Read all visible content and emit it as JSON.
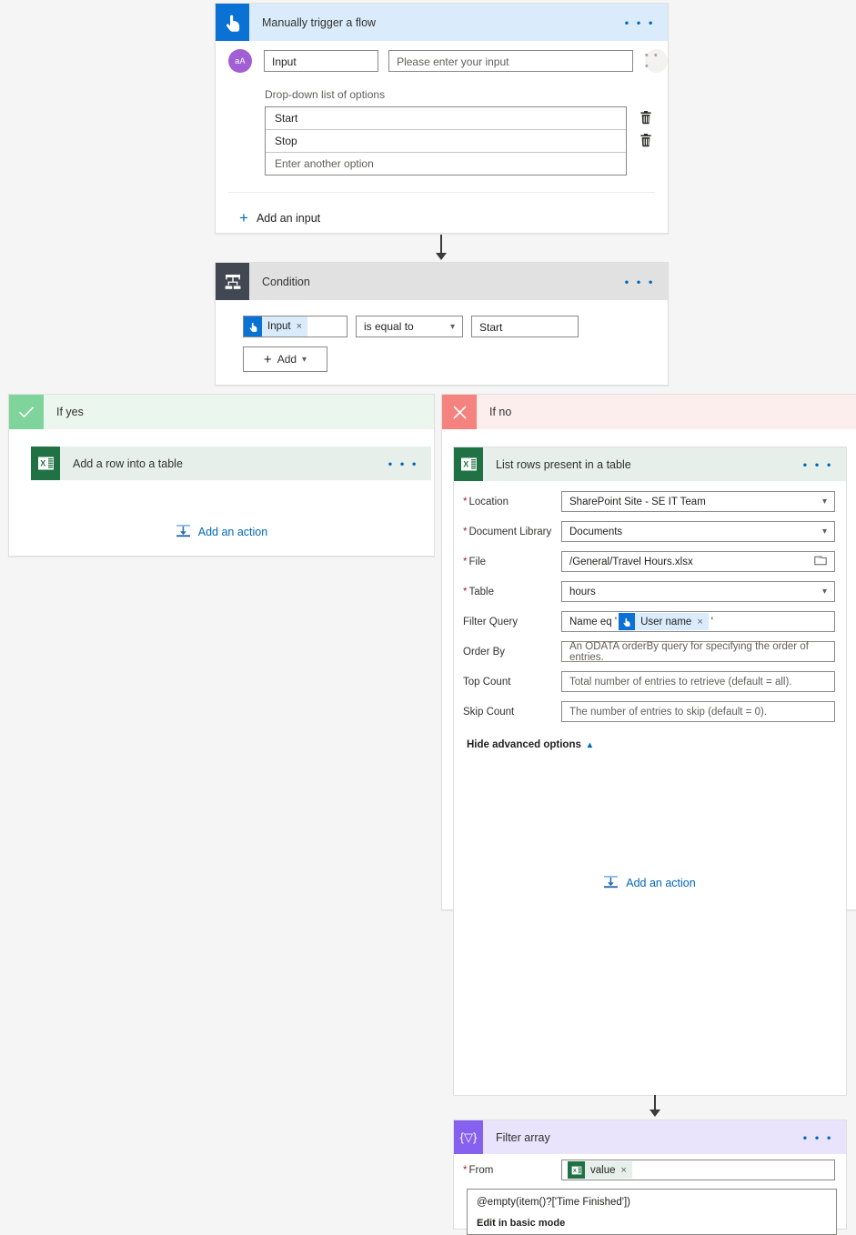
{
  "trigger": {
    "title": "Manually trigger a flow",
    "icon": "touch-trigger-icon",
    "menu": "• • •",
    "input_type_icon": "text-input-type-icon",
    "input_type_label": "aA",
    "input_name": "Input",
    "input_description_placeholder": "Please enter your input",
    "row_menu": "• • •",
    "dropdown_label": "Drop-down list of options",
    "options": [
      "Start",
      "Stop"
    ],
    "new_option_placeholder": "Enter another option",
    "delete_icon": "trash-icon",
    "add_input_label": "Add an input",
    "add_input_plus": "+"
  },
  "condition": {
    "title": "Condition",
    "icon": "condition-branch-icon",
    "menu": "• • •",
    "left_token": "Input",
    "left_token_icon": "touch-trigger-icon",
    "token_remove": "×",
    "operator": "is equal to",
    "operator_chevron": "chevron-down-icon",
    "right_value": "Start",
    "add_label": "Add",
    "add_plus": "+",
    "add_chevron": "chevron-down-icon"
  },
  "branch_yes": {
    "label": "If yes",
    "icon": "check-icon",
    "action": {
      "title": "Add a row into a table",
      "icon": "excel-icon",
      "menu": "• • •"
    },
    "add_action_label": "Add an action",
    "add_action_icon": "insert-action-icon"
  },
  "branch_no": {
    "label": "If no",
    "icon": "close-icon",
    "list_rows": {
      "title": "List rows present in a table",
      "icon": "excel-icon",
      "menu": "• • •",
      "fields": [
        {
          "label": "Location",
          "required": true,
          "value": "SharePoint Site - SE IT Team",
          "control": "dropdown",
          "placeholder": false
        },
        {
          "label": "Document Library",
          "required": true,
          "value": "Documents",
          "control": "dropdown",
          "placeholder": false
        },
        {
          "label": "File",
          "required": true,
          "value": "/General/Travel Hours.xlsx",
          "control": "filepicker",
          "placeholder": false
        },
        {
          "label": "Table",
          "required": true,
          "value": "hours",
          "control": "dropdown",
          "placeholder": false
        },
        {
          "label": "Filter Query",
          "required": false,
          "value": "",
          "control": "token",
          "placeholder": false
        },
        {
          "label": "Order By",
          "required": false,
          "value": "An ODATA orderBy query for specifying the order of entries.",
          "control": "text",
          "placeholder": true
        },
        {
          "label": "Top Count",
          "required": false,
          "value": "Total number of entries to retrieve (default = all).",
          "control": "text",
          "placeholder": true
        },
        {
          "label": "Skip Count",
          "required": false,
          "value": "The number of entries to skip (default = 0).",
          "control": "text",
          "placeholder": true
        }
      ],
      "filter_query": {
        "prefix": "Name eq '",
        "token": "User name",
        "token_icon": "touch-trigger-icon",
        "token_remove": "×",
        "suffix": "'"
      },
      "advanced_toggle": "Hide advanced options",
      "advanced_chevron": "chevron-up-icon"
    },
    "filter_array": {
      "title": "Filter array",
      "icon": "filter-array-icon",
      "icon_glyph": "{▽}",
      "menu": "• • •",
      "from_label": "From",
      "from_required": true,
      "from_token": "value",
      "from_token_icon": "excel-icon",
      "from_token_remove": "×",
      "expression": "@empty(item()?['Time Finished'])",
      "mode_link": "Edit in basic mode"
    },
    "add_action_label": "Add an action",
    "add_action_icon": "insert-action-icon"
  },
  "colors": {
    "canvas": "#f5f5f5",
    "trigger_header": "#daecfb",
    "trigger_icon": "#0b72d5",
    "condition_header": "#e1e1e1",
    "condition_icon": "#414852",
    "yes_header": "#eaf6ee",
    "yes_icon": "#7ed49a",
    "no_header": "#fdeeee",
    "no_icon": "#f4827f",
    "excel_icon": "#207245",
    "filter_icon": "#8661ef",
    "link": "#0067b8",
    "required": "#a4262c"
  }
}
